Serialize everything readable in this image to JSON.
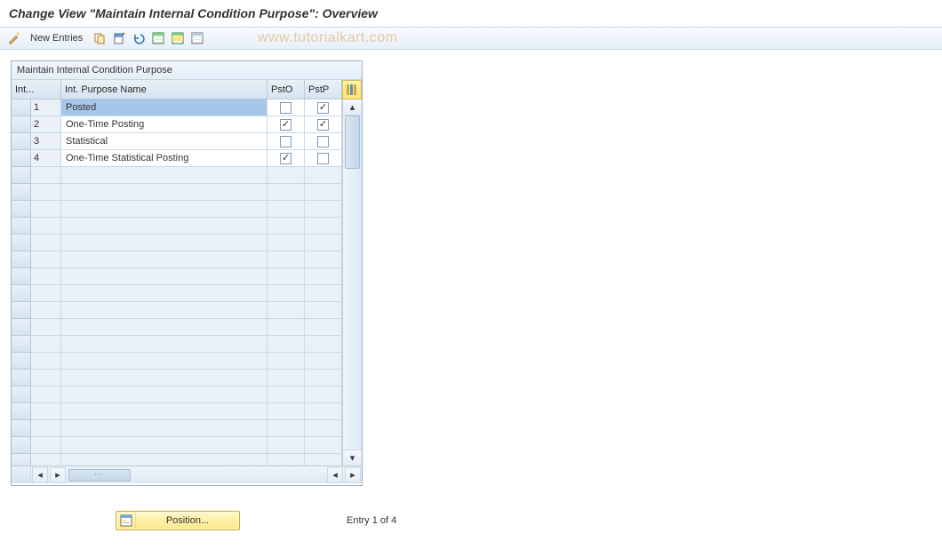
{
  "title": "Change View \"Maintain Internal Condition Purpose\": Overview",
  "watermark": "www.tutorialkart.com",
  "toolbar": {
    "new_entries": "New Entries"
  },
  "panel": {
    "title": "Maintain Internal Condition Purpose",
    "columns": {
      "id": "Int...",
      "name": "Int. Purpose Name",
      "psto": "PstO",
      "pstp": "PstP"
    },
    "rows": [
      {
        "id": "1",
        "name": "Posted",
        "psto": false,
        "pstp": true,
        "selected": true
      },
      {
        "id": "2",
        "name": "One-Time Posting",
        "psto": true,
        "pstp": true,
        "selected": false
      },
      {
        "id": "3",
        "name": "Statistical",
        "psto": false,
        "pstp": false,
        "selected": false
      },
      {
        "id": "4",
        "name": "One-Time Statistical Posting",
        "psto": true,
        "pstp": false,
        "selected": false
      }
    ],
    "empty_row_count": 18,
    "hscroll": {
      "left_gap": true
    }
  },
  "footer": {
    "position_label": "Position...",
    "entry_text": "Entry 1 of 4"
  },
  "colors": {
    "accent_yellow": "#ffe98a",
    "header_blue": "#d6e4f0",
    "selected_blue": "#a7c7ea"
  }
}
